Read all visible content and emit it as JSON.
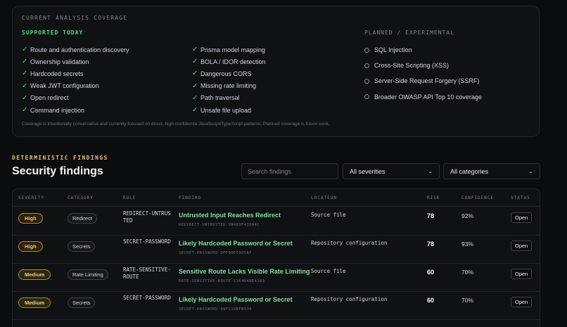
{
  "coverage": {
    "title": "CURRENT ANALYSIS COVERAGE",
    "supported_title": "SUPPORTED TODAY",
    "supported_col1": [
      "Route and authentication discovery",
      "Ownership validation",
      "Hardcoded secrets",
      "Weak JWT configuration",
      "Open redirect",
      "Command injection"
    ],
    "supported_col2": [
      "Prisma model mapping",
      "BOLA / IDOR detection",
      "Dangerous CORS",
      "Missing rate limiting",
      "Path traversal",
      "Unsafe file upload"
    ],
    "planned_title": "PLANNED / EXPERIMENTAL",
    "planned": [
      "SQL Injection",
      "Cross-Site Scripting (XSS)",
      "Server-Side Request Forgery (SSRF)",
      "Broader OWASP API Top 10 coverage"
    ],
    "note": "Coverage is intentionally conservative and currently focused on direct, high-confidence JavaScript/TypeScript patterns. Planned coverage is future work."
  },
  "findings": {
    "section_label": "DETERMINISTIC FINDINGS",
    "title": "Security findings",
    "search_placeholder": "Search findings",
    "severity_filter": "All severities",
    "category_filter": "All categories",
    "columns": [
      "SEVERITY",
      "CATEGORY",
      "RULE",
      "FINDING",
      "LOCATION",
      "RISK",
      "CONFIDENCE",
      "STATUS"
    ],
    "rows": [
      {
        "severity": "High",
        "category": "Redirect",
        "rule": "REDIRECT-UNTRUSTED",
        "title": "Untrusted Input Reaches Redirect",
        "id": "REDIRECT-UNTRUSTED-5B489F430A4C",
        "location": "Source file",
        "risk": "78",
        "confidence": "92%",
        "status": "Open"
      },
      {
        "severity": "High",
        "category": "Secrets",
        "rule": "SECRET-PASSWORD",
        "title": "Likely Hardcoded Password or Secret",
        "id": "SECRET-PASSWORD-DFF00E5995AF",
        "location": "Repository configuration",
        "risk": "78",
        "confidence": "93%",
        "status": "Open"
      },
      {
        "severity": "Medium",
        "category": "Rate Limiting",
        "rule": "RATE-SENSITIVE-ROUTE",
        "title": "Sensitive Route Lacks Visible Rate Limiting",
        "id": "RATE-SENSITIVE-ROUTE-536464BE4183",
        "location": "Source file",
        "risk": "60",
        "confidence": "70%",
        "status": "Open"
      },
      {
        "severity": "Medium",
        "category": "Secrets",
        "rule": "SECRET-PASSWORD",
        "title": "Likely Hardcoded Password or Secret",
        "id": "SECRET-PASSWORD-09FC19BFB939",
        "location": "Repository configuration",
        "risk": "60",
        "confidence": "70%",
        "status": "Open"
      }
    ]
  },
  "colors": {
    "accent_green": "#4ade80",
    "high": "#f2c26b",
    "medium": "#efd27a",
    "background": "#0b0c0e"
  },
  "icons": {
    "supported": "check-icon",
    "planned": "circle-icon",
    "dropdown": "chevron-down-icon"
  }
}
